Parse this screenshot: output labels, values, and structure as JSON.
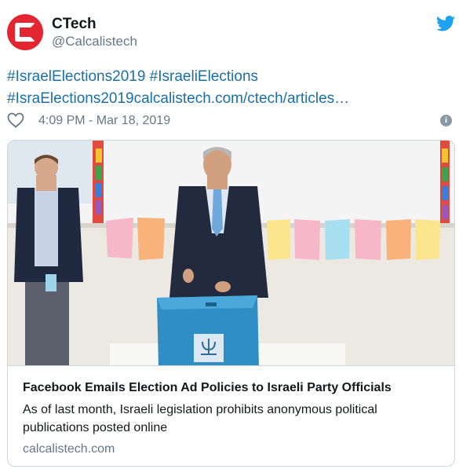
{
  "account": {
    "display_name": "CTech",
    "handle": "@Calcalistech"
  },
  "tweet": {
    "text_line1": "#IsraelElections2019 #IsraeliElections",
    "text_line2": "#IsraElections2019calcalistech.com/ctech/articles…",
    "timestamp": "4:09 PM - Mar 18, 2019"
  },
  "card": {
    "title": "Facebook Emails Election Ad Policies to Israeli Party Officials",
    "description": "As of last month, Israeli legislation prohibits anonymous political publications posted online",
    "domain": "calcalistech.com"
  },
  "icons": {
    "avatar": "ctech-logo-icon",
    "bird": "twitter-bird-icon",
    "heart": "heart-icon",
    "info": "info-icon"
  },
  "colors": {
    "brand_red": "#e3262f",
    "link_blue": "#1b6fa6",
    "twitter_blue": "#1da1f2",
    "muted": "#657786",
    "ballot_box": "#2f8fc4"
  }
}
